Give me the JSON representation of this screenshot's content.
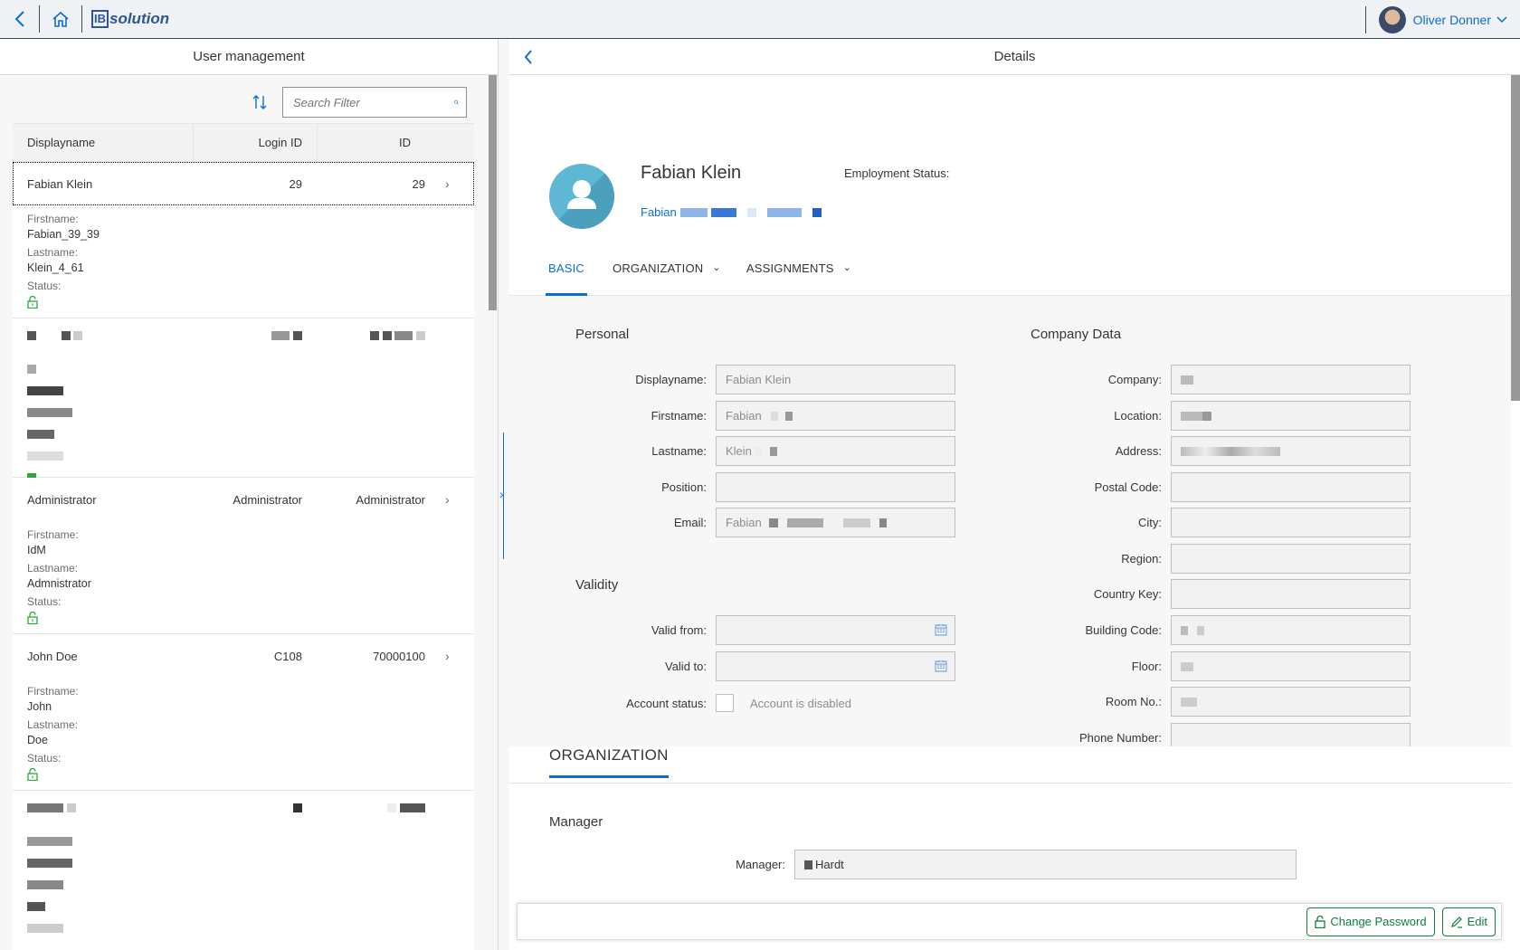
{
  "shell": {
    "logo_ib": "IB",
    "logo_text": "solution",
    "user_name": "Oliver Donner"
  },
  "master": {
    "title": "User management",
    "search_placeholder": "Search Filter",
    "columns": {
      "display": "Displayname",
      "login": "Login ID",
      "id": "ID"
    },
    "rows": [
      {
        "display": "Fabian Klein",
        "login": "29",
        "id": "29",
        "firstname_label": "Firstname:",
        "firstname": "Fabian_39_39",
        "lastname_label": "Lastname:",
        "lastname": "Klein_4_61",
        "status_label": "Status:"
      },
      {
        "display": "Administrator",
        "login": "Administrator",
        "id": "Administrator",
        "firstname_label": "Firstname:",
        "firstname": "IdM",
        "lastname_label": "Lastname:",
        "lastname": "Admnistrator",
        "status_label": "Status:"
      },
      {
        "display": "John Doe",
        "login": "C108",
        "id": "70000100",
        "firstname_label": "Firstname:",
        "firstname": "John",
        "lastname_label": "Lastname:",
        "lastname": "Doe",
        "status_label": "Status:"
      }
    ]
  },
  "detail": {
    "title": "Details",
    "name": "Fabian Klein",
    "subtitle": "Fabian",
    "employment_status_label": "Employment Status:",
    "tabs": [
      "BASIC",
      "ORGANIZATION",
      "ASSIGNMENTS"
    ],
    "personal": {
      "title": "Personal",
      "displayname_label": "Displayname:",
      "displayname": "Fabian Klein",
      "firstname_label": "Firstname:",
      "firstname": "Fabian",
      "lastname_label": "Lastname:",
      "lastname": "Klein",
      "position_label": "Position:",
      "position": "",
      "email_label": "Email:",
      "email": "Fabian"
    },
    "validity": {
      "title": "Validity",
      "valid_from_label": "Valid from:",
      "valid_to_label": "Valid to:",
      "account_status_label": "Account status:",
      "account_disabled_text": "Account is disabled"
    },
    "company": {
      "title": "Company Data",
      "company_label": "Company:",
      "location_label": "Location:",
      "address_label": "Address:",
      "postal_code_label": "Postal Code:",
      "city_label": "City:",
      "region_label": "Region:",
      "country_key_label": "Country Key:",
      "building_code_label": "Building Code:",
      "floor_label": "Floor:",
      "room_label": "Room No.:",
      "phone_label": "Phone Number:"
    },
    "organization": {
      "title": "ORGANIZATION",
      "manager_group": "Manager",
      "manager_label": "Manager:",
      "manager_value": "Hardt"
    },
    "footer": {
      "change_password": "Change Password",
      "edit": "Edit"
    }
  },
  "colors": {
    "accent": "#0a6ed1",
    "positive": "#107e3e",
    "avatar": "#5eb8d4",
    "unlocked": "#2ea83a"
  }
}
